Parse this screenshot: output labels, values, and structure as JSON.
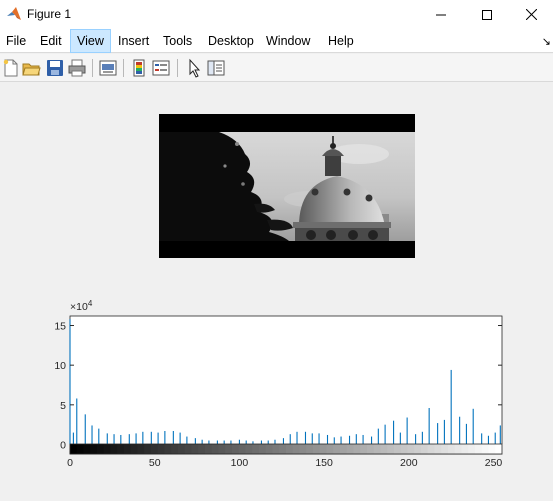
{
  "window": {
    "title": "Figure 1"
  },
  "menu": [
    "File",
    "Edit",
    "View",
    "Insert",
    "Tools",
    "Desktop",
    "Window",
    "Help"
  ],
  "menu_active": "View",
  "toolbar_icons": [
    "new-figure-icon",
    "open-file-icon",
    "save-icon",
    "print-icon",
    "print-preview-icon",
    "colorbar-icon",
    "legend-icon",
    "edit-plot-arrow-icon",
    "property-inspector-icon"
  ],
  "chart_data": {
    "type": "bar",
    "exponent_label": "×10",
    "exponent_power": "4",
    "xlim": [
      0,
      255
    ],
    "ylim": [
      -1.2,
      16.2
    ],
    "xticks": [
      0,
      50,
      100,
      150,
      200,
      250
    ],
    "yticks": [
      0,
      5,
      10,
      15
    ],
    "grid": false,
    "colorbar": "grayscale 0-255 below axis",
    "bar_color": "#0072bd",
    "x": [
      0,
      2,
      4,
      9,
      13,
      17,
      22,
      26,
      30,
      35,
      39,
      43,
      48,
      52,
      56,
      61,
      65,
      69,
      74,
      78,
      82,
      87,
      91,
      95,
      100,
      104,
      108,
      113,
      117,
      121,
      126,
      130,
      134,
      139,
      143,
      147,
      152,
      156,
      160,
      165,
      169,
      173,
      178,
      182,
      186,
      191,
      195,
      199,
      204,
      208,
      212,
      217,
      221,
      225,
      230,
      234,
      238,
      243,
      247,
      251,
      254
    ],
    "values": [
      15.8,
      1.5,
      5.8,
      3.8,
      2.4,
      2.0,
      1.4,
      1.3,
      1.2,
      1.3,
      1.4,
      1.6,
      1.6,
      1.5,
      1.7,
      1.7,
      1.5,
      1.0,
      0.8,
      0.6,
      0.5,
      0.5,
      0.5,
      0.5,
      0.6,
      0.5,
      0.4,
      0.5,
      0.5,
      0.6,
      0.8,
      1.3,
      1.6,
      1.6,
      1.4,
      1.4,
      1.2,
      0.9,
      1.0,
      1.1,
      1.3,
      1.2,
      1.0,
      2.0,
      2.5,
      3.0,
      1.5,
      3.4,
      1.3,
      1.6,
      4.6,
      2.7,
      3.1,
      9.4,
      3.5,
      2.6,
      4.5,
      1.4,
      1.1,
      1.5,
      2.4
    ]
  }
}
